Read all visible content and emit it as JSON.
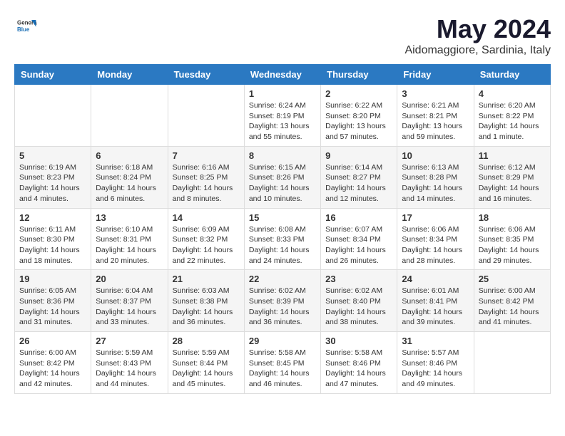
{
  "header": {
    "logo_general": "General",
    "logo_blue": "Blue",
    "month_title": "May 2024",
    "location": "Aidomaggiore, Sardinia, Italy"
  },
  "days_of_week": [
    "Sunday",
    "Monday",
    "Tuesday",
    "Wednesday",
    "Thursday",
    "Friday",
    "Saturday"
  ],
  "weeks": [
    [
      {
        "day": "",
        "info": ""
      },
      {
        "day": "",
        "info": ""
      },
      {
        "day": "",
        "info": ""
      },
      {
        "day": "1",
        "info": "Sunrise: 6:24 AM\nSunset: 8:19 PM\nDaylight: 13 hours\nand 55 minutes."
      },
      {
        "day": "2",
        "info": "Sunrise: 6:22 AM\nSunset: 8:20 PM\nDaylight: 13 hours\nand 57 minutes."
      },
      {
        "day": "3",
        "info": "Sunrise: 6:21 AM\nSunset: 8:21 PM\nDaylight: 13 hours\nand 59 minutes."
      },
      {
        "day": "4",
        "info": "Sunrise: 6:20 AM\nSunset: 8:22 PM\nDaylight: 14 hours\nand 1 minute."
      }
    ],
    [
      {
        "day": "5",
        "info": "Sunrise: 6:19 AM\nSunset: 8:23 PM\nDaylight: 14 hours\nand 4 minutes."
      },
      {
        "day": "6",
        "info": "Sunrise: 6:18 AM\nSunset: 8:24 PM\nDaylight: 14 hours\nand 6 minutes."
      },
      {
        "day": "7",
        "info": "Sunrise: 6:16 AM\nSunset: 8:25 PM\nDaylight: 14 hours\nand 8 minutes."
      },
      {
        "day": "8",
        "info": "Sunrise: 6:15 AM\nSunset: 8:26 PM\nDaylight: 14 hours\nand 10 minutes."
      },
      {
        "day": "9",
        "info": "Sunrise: 6:14 AM\nSunset: 8:27 PM\nDaylight: 14 hours\nand 12 minutes."
      },
      {
        "day": "10",
        "info": "Sunrise: 6:13 AM\nSunset: 8:28 PM\nDaylight: 14 hours\nand 14 minutes."
      },
      {
        "day": "11",
        "info": "Sunrise: 6:12 AM\nSunset: 8:29 PM\nDaylight: 14 hours\nand 16 minutes."
      }
    ],
    [
      {
        "day": "12",
        "info": "Sunrise: 6:11 AM\nSunset: 8:30 PM\nDaylight: 14 hours\nand 18 minutes."
      },
      {
        "day": "13",
        "info": "Sunrise: 6:10 AM\nSunset: 8:31 PM\nDaylight: 14 hours\nand 20 minutes."
      },
      {
        "day": "14",
        "info": "Sunrise: 6:09 AM\nSunset: 8:32 PM\nDaylight: 14 hours\nand 22 minutes."
      },
      {
        "day": "15",
        "info": "Sunrise: 6:08 AM\nSunset: 8:33 PM\nDaylight: 14 hours\nand 24 minutes."
      },
      {
        "day": "16",
        "info": "Sunrise: 6:07 AM\nSunset: 8:34 PM\nDaylight: 14 hours\nand 26 minutes."
      },
      {
        "day": "17",
        "info": "Sunrise: 6:06 AM\nSunset: 8:34 PM\nDaylight: 14 hours\nand 28 minutes."
      },
      {
        "day": "18",
        "info": "Sunrise: 6:06 AM\nSunset: 8:35 PM\nDaylight: 14 hours\nand 29 minutes."
      }
    ],
    [
      {
        "day": "19",
        "info": "Sunrise: 6:05 AM\nSunset: 8:36 PM\nDaylight: 14 hours\nand 31 minutes."
      },
      {
        "day": "20",
        "info": "Sunrise: 6:04 AM\nSunset: 8:37 PM\nDaylight: 14 hours\nand 33 minutes."
      },
      {
        "day": "21",
        "info": "Sunrise: 6:03 AM\nSunset: 8:38 PM\nDaylight: 14 hours\nand 36 minutes."
      },
      {
        "day": "22",
        "info": "Sunrise: 6:02 AM\nSunset: 8:39 PM\nDaylight: 14 hours\nand 36 minutes."
      },
      {
        "day": "23",
        "info": "Sunrise: 6:02 AM\nSunset: 8:40 PM\nDaylight: 14 hours\nand 38 minutes."
      },
      {
        "day": "24",
        "info": "Sunrise: 6:01 AM\nSunset: 8:41 PM\nDaylight: 14 hours\nand 39 minutes."
      },
      {
        "day": "25",
        "info": "Sunrise: 6:00 AM\nSunset: 8:42 PM\nDaylight: 14 hours\nand 41 minutes."
      }
    ],
    [
      {
        "day": "26",
        "info": "Sunrise: 6:00 AM\nSunset: 8:42 PM\nDaylight: 14 hours\nand 42 minutes."
      },
      {
        "day": "27",
        "info": "Sunrise: 5:59 AM\nSunset: 8:43 PM\nDaylight: 14 hours\nand 44 minutes."
      },
      {
        "day": "28",
        "info": "Sunrise: 5:59 AM\nSunset: 8:44 PM\nDaylight: 14 hours\nand 45 minutes."
      },
      {
        "day": "29",
        "info": "Sunrise: 5:58 AM\nSunset: 8:45 PM\nDaylight: 14 hours\nand 46 minutes."
      },
      {
        "day": "30",
        "info": "Sunrise: 5:58 AM\nSunset: 8:46 PM\nDaylight: 14 hours\nand 47 minutes."
      },
      {
        "day": "31",
        "info": "Sunrise: 5:57 AM\nSunset: 8:46 PM\nDaylight: 14 hours\nand 49 minutes."
      },
      {
        "day": "",
        "info": ""
      }
    ]
  ]
}
